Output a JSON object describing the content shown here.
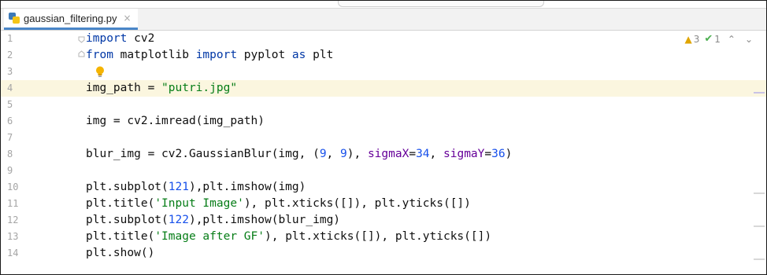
{
  "tab": {
    "filename": "gaussian_filtering.py",
    "close_glyph": "×",
    "icon": "python-file-icon"
  },
  "inspections": {
    "warnings": "3",
    "weak_warnings": "1",
    "warning_icon": "▲",
    "check_icon": "✔",
    "up_arrow": "⌃",
    "down_arrow": "⌄"
  },
  "lines": [
    {
      "num": "1",
      "tokens": [
        {
          "t": "import",
          "c": "kw"
        },
        {
          "t": " cv2",
          "c": ""
        }
      ]
    },
    {
      "num": "2",
      "tokens": [
        {
          "t": "from",
          "c": "kw"
        },
        {
          "t": " matplotlib ",
          "c": ""
        },
        {
          "t": "import",
          "c": "kw"
        },
        {
          "t": " pyplot ",
          "c": ""
        },
        {
          "t": "as",
          "c": "kw"
        },
        {
          "t": " plt",
          "c": ""
        }
      ]
    },
    {
      "num": "3",
      "tokens": []
    },
    {
      "num": "4",
      "tokens": [
        {
          "t": "img_path = ",
          "c": ""
        },
        {
          "t": "\"putri.jpg\"",
          "c": "str"
        }
      ]
    },
    {
      "num": "5",
      "tokens": []
    },
    {
      "num": "6",
      "tokens": [
        {
          "t": "img = cv2.imread(img_path)",
          "c": ""
        }
      ]
    },
    {
      "num": "7",
      "tokens": []
    },
    {
      "num": "8",
      "tokens": [
        {
          "t": "blur_img = cv2.GaussianBlur(img, (",
          "c": ""
        },
        {
          "t": "9",
          "c": "num"
        },
        {
          "t": ", ",
          "c": ""
        },
        {
          "t": "9",
          "c": "num"
        },
        {
          "t": "), ",
          "c": ""
        },
        {
          "t": "sigmaX",
          "c": "param"
        },
        {
          "t": "=",
          "c": ""
        },
        {
          "t": "34",
          "c": "num"
        },
        {
          "t": ", ",
          "c": ""
        },
        {
          "t": "sigmaY",
          "c": "param"
        },
        {
          "t": "=",
          "c": ""
        },
        {
          "t": "36",
          "c": "num"
        },
        {
          "t": ")",
          "c": ""
        }
      ]
    },
    {
      "num": "9",
      "tokens": []
    },
    {
      "num": "10",
      "tokens": [
        {
          "t": "plt.subplot(",
          "c": ""
        },
        {
          "t": "121",
          "c": "num"
        },
        {
          "t": "),plt.imshow(img)",
          "c": ""
        }
      ]
    },
    {
      "num": "11",
      "tokens": [
        {
          "t": "plt.title(",
          "c": ""
        },
        {
          "t": "'Input Image'",
          "c": "str"
        },
        {
          "t": "), plt.xticks([]), plt.yticks([])",
          "c": ""
        }
      ]
    },
    {
      "num": "12",
      "tokens": [
        {
          "t": "plt.subplot(",
          "c": ""
        },
        {
          "t": "122",
          "c": "num"
        },
        {
          "t": "),plt.imshow(blur_img)",
          "c": ""
        }
      ]
    },
    {
      "num": "13",
      "tokens": [
        {
          "t": "plt.title(",
          "c": ""
        },
        {
          "t": "'Image after GF'",
          "c": "str"
        },
        {
          "t": "), plt.xticks([]), plt.yticks([])",
          "c": ""
        }
      ]
    },
    {
      "num": "14",
      "tokens": [
        {
          "t": "plt.show()",
          "c": ""
        }
      ]
    }
  ],
  "highlighted_line": "4",
  "colors": {
    "keyword": "#0037a6",
    "string": "#067d17",
    "number": "#1750eb",
    "param": "#660099",
    "current_line": "#fbf6df"
  }
}
